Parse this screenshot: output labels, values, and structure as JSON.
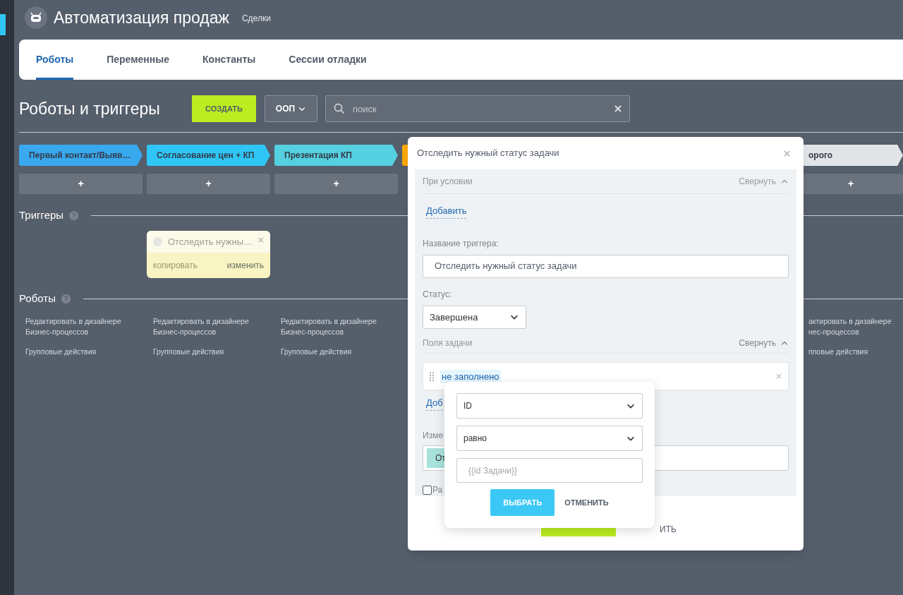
{
  "header": {
    "title": "Автоматизация продаж",
    "subtitle": "Сделки"
  },
  "tabs": [
    {
      "label": "Роботы",
      "selected": true
    },
    {
      "label": "Переменные",
      "selected": false
    },
    {
      "label": "Константы",
      "selected": false
    },
    {
      "label": "Сессии отладки",
      "selected": false
    }
  ],
  "toolbar": {
    "title": "Роботы и триггеры",
    "create_button": "СОЗДАТЬ",
    "category": "ООП",
    "search": {
      "placeholder": "поиск"
    }
  },
  "stages": [
    {
      "label": "Первый контакт/Выяв…",
      "color": "#39a9ef",
      "add_label": "+"
    },
    {
      "label": "Согласование цен + КП",
      "color": "#2fc6f6",
      "add_label": "+"
    },
    {
      "label": "Презентация КП",
      "color": "#55d0e0",
      "add_label": "+"
    },
    {
      "color": "#ffa900"
    },
    {
      "label": "орого",
      "color": "#e2e5e8",
      "add_label": "+"
    }
  ],
  "triggers": {
    "title": "Триггеры",
    "cards": [
      {
        "title": "Отследить нужны…",
        "copy_link": "копировать",
        "edit_link": "изменить"
      }
    ]
  },
  "robots": {
    "title": "Роботы",
    "columns": [
      {
        "edit_link": "Редактировать в дизайнере Бизнес-процессов",
        "group_link": "Групповые действия"
      },
      {
        "edit_link": "Редактировать в дизайнере Бизнес-процессов",
        "group_link": "Групповые действия"
      },
      {
        "edit_link": "Редактировать в дизайнере Бизнес-процессов",
        "group_link": "Групповые действия"
      }
    ],
    "right_fragment": {
      "edit_link": "актировать в дизайнере нес-процессов",
      "group_link": "пповые действия"
    }
  },
  "modal": {
    "title": "Отследить нужный статус задачи",
    "condition": {
      "label": "При условии",
      "collapse": "Свернуть",
      "add_link": "Добавить"
    },
    "name_field": {
      "label": "Название триггера:",
      "value": "Отследить нужный статус задачи"
    },
    "status": {
      "label": "Статус:",
      "value": "Завершена"
    },
    "task_fields": {
      "label": "Поля задачи",
      "collapse": "Свернуть",
      "chip": "не заполнено",
      "add_link": "Доб"
    },
    "changed": {
      "label": "Изме",
      "chip": "От"
    },
    "checkbox": {
      "label": "Ра",
      "checked": false
    },
    "footer": {
      "cancel": "ИТЬ"
    },
    "popup": {
      "field": "ID",
      "operator": "равно",
      "value": {
        "placeholder": "{{id Задачи}}"
      },
      "select_button": "ВЫБРАТЬ",
      "cancel_button": "ОТМЕНИТЬ"
    }
  }
}
